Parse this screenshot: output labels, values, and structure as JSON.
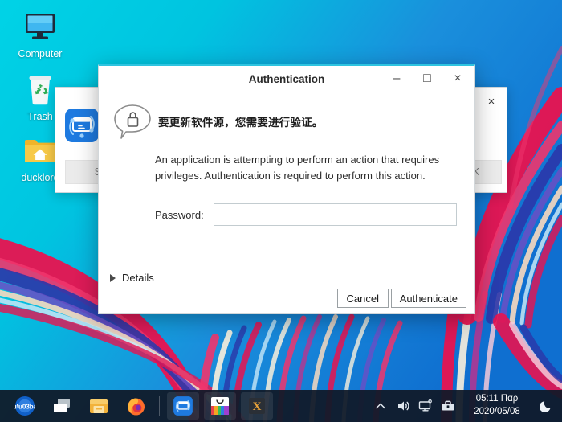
{
  "desktop": {
    "icons": [
      {
        "label": "Computer",
        "icon": "computer-monitor-icon"
      },
      {
        "label": "Trash",
        "icon": "trash-bin-icon"
      },
      {
        "label": "ducklord",
        "icon": "home-folder-icon"
      }
    ]
  },
  "background_window": {
    "close_label": "×",
    "app_icon": "settings-sync-icon",
    "left_button_label": "Setti",
    "right_button_label": "K"
  },
  "dialog": {
    "title": "Authentication",
    "window_controls": {
      "minimize": "–",
      "maximize": "□",
      "close": "×"
    },
    "lock_icon": "lock-bubble-icon",
    "heading": "要更新软件源，您需要进行验证。",
    "description": "An application is attempting to perform an action that requires privileges. Authentication is required to perform this action.",
    "password_label": "Password:",
    "password_value": "",
    "password_placeholder": "",
    "details_label": "Details",
    "cancel_label": "Cancel",
    "authenticate_label": "Authenticate",
    "accent_color": "#2ec4e0"
  },
  "taskbar": {
    "launchers": [
      {
        "name": "start-menu-icon",
        "running": false
      },
      {
        "name": "file-manager-icon",
        "running": false
      },
      {
        "name": "archive-icon",
        "running": false
      },
      {
        "name": "firefox-icon",
        "running": false
      }
    ],
    "running_apps": [
      {
        "name": "settings-sync-icon",
        "running": true
      },
      {
        "name": "app-store-icon",
        "running": true
      },
      {
        "name": "xterm-icon",
        "running": true
      }
    ],
    "tray": [
      {
        "name": "chevron-up-icon"
      },
      {
        "name": "volume-icon"
      },
      {
        "name": "display-network-icon"
      },
      {
        "name": "toolbox-icon"
      }
    ],
    "clock": {
      "time": "05:11 Παρ",
      "date": "2020/05/08"
    },
    "night_mode_icon": "crescent-moon-icon"
  }
}
